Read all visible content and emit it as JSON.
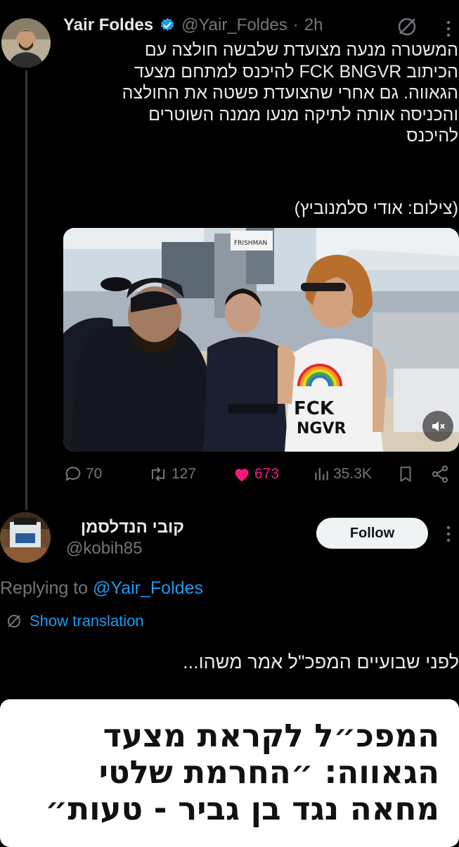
{
  "tweet": {
    "author_name": "Yair Foldes",
    "handle": "@Yair_Foldes",
    "separator": "·",
    "time": "2h",
    "text_lines": [
      "המשטרה מנעה מצועדת שלבשה חולצה עם",
      "הכיתוב FCK BNGVR להיכנס למתחם מצעד",
      "הגאווה. גם אחרי שהצועדת פשטה את החולצה",
      "והכניסה אותה לתיקה מנעו ממנה השוטרים",
      "להיכנס"
    ],
    "credit": "(צילום: אודי סלמנוביץ)",
    "media": {
      "shirt_text_line1": "FCK",
      "shirt_text_line2": "NGVR",
      "sign_text": "FRISHMAN"
    },
    "stats": {
      "replies": "70",
      "reposts": "127",
      "likes": "673",
      "views": "35.3K"
    }
  },
  "reply": {
    "author_name": "קובי הנדלסמן",
    "handle": "@kobih85",
    "follow_label": "Follow",
    "replying_prefix": "Replying to",
    "replying_to": "@Yair_Foldes",
    "show_translation": "Show translation",
    "text": "לפני שבועיים המפכ\"ל אמר משהו...",
    "headline_lines": [
      "המפכ״ל לקראת מצעד",
      "הגאווה: ״החרמת שלטי",
      "מחאה נגד בן גביר - טעות״"
    ]
  },
  "colors": {
    "background": "#000000",
    "text": "#e7e9ea",
    "secondary": "#71767b",
    "accent": "#1d9bf0",
    "like": "#f91880",
    "verified": "#1d9bf0"
  },
  "icons": {
    "verified": "verified-badge-icon",
    "grok": "slashed-circle-icon",
    "more": "more-vertical-icon",
    "reply": "reply-icon",
    "repost": "repost-icon",
    "like": "heart-icon",
    "views": "views-icon",
    "bookmark": "bookmark-icon",
    "share": "share-icon",
    "mute": "muted-speaker-icon",
    "translate": "globe-icon"
  }
}
